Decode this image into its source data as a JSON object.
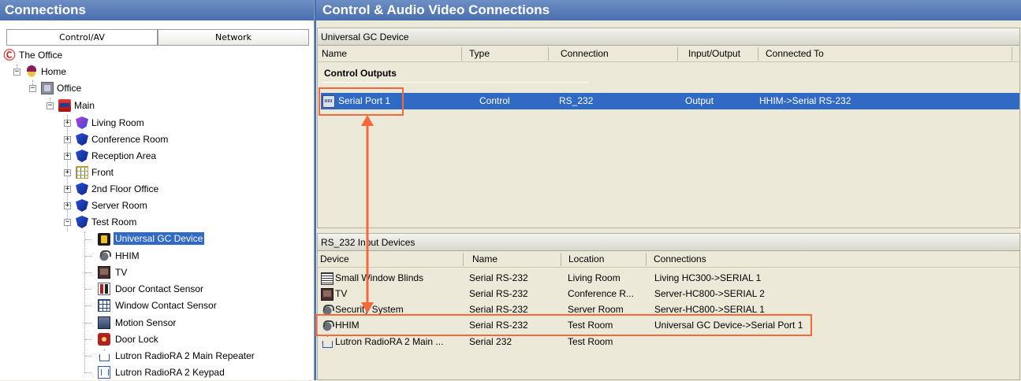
{
  "left": {
    "header": "Connections",
    "tabs": [
      {
        "label": "Control/AV"
      },
      {
        "label": "Network"
      }
    ],
    "tree": [
      {
        "label": "The Office",
        "icon": "c4-logo-icon"
      },
      {
        "label": "Home",
        "icon": "home-icon"
      },
      {
        "label": "Office",
        "icon": "office-icon"
      },
      {
        "label": "Main",
        "icon": "main-icon"
      },
      {
        "label": "Living Room",
        "icon": "room-shield-icon"
      },
      {
        "label": "Conference Room",
        "icon": "room-shield-icon"
      },
      {
        "label": "Reception Area",
        "icon": "room-shield-icon"
      },
      {
        "label": "Front",
        "icon": "front-grid-icon"
      },
      {
        "label": "2nd Floor Office",
        "icon": "room-shield-icon"
      },
      {
        "label": "Server Room",
        "icon": "room-shield-icon"
      },
      {
        "label": "Test Room",
        "icon": "room-shield-icon"
      },
      {
        "label": "Universal GC Device",
        "icon": "gc-device-icon"
      },
      {
        "label": "HHIM",
        "icon": "hhim-icon"
      },
      {
        "label": "TV",
        "icon": "tv-icon"
      },
      {
        "label": "Door Contact Sensor",
        "icon": "door-contact-icon"
      },
      {
        "label": "Window Contact Sensor",
        "icon": "window-contact-icon"
      },
      {
        "label": "Motion Sensor",
        "icon": "motion-sensor-icon"
      },
      {
        "label": "Door Lock",
        "icon": "door-lock-icon"
      },
      {
        "label": "Lutron RadioRA 2 Main Repeater",
        "icon": "lutron-repeater-icon"
      },
      {
        "label": "Lutron RadioRA 2 Keypad",
        "icon": "lutron-keypad-icon"
      }
    ]
  },
  "right": {
    "header": "Control & Audio Video Connections",
    "top_panel": {
      "title": "Universal GC Device",
      "columns": [
        "Name",
        "Type",
        "Connection",
        "Input/Output",
        "Connected To"
      ],
      "group": "Control Outputs",
      "rows": [
        {
          "name": "Serial Port 1",
          "type": "Control",
          "connection": "RS_232",
          "io": "Output",
          "connected_to": "HHIM->Serial RS-232"
        }
      ]
    },
    "bottom_panel": {
      "title": "RS_232 Input Devices",
      "columns": [
        "Device",
        "Name",
        "Location",
        "Connections"
      ],
      "rows": [
        {
          "device": "Small Window Blinds",
          "name": "Serial RS-232",
          "location": "Living Room",
          "connections": "Living HC300->SERIAL 1"
        },
        {
          "device": "TV",
          "name": "Serial RS-232",
          "location": "Conference R...",
          "connections": "Server-HC800->SERIAL 2"
        },
        {
          "device": "Security System",
          "name": "Serial RS-232",
          "location": "Server Room",
          "connections": "Server-HC800->SERIAL 1"
        },
        {
          "device": "HHIM",
          "name": "Serial RS-232",
          "location": "Test Room",
          "connections": "Universal GC Device->Serial Port 1"
        },
        {
          "device": "Lutron RadioRA 2 Main ...",
          "name": "Serial 232",
          "location": "Test Room",
          "connections": ""
        }
      ]
    }
  },
  "colors": {
    "header_blue": "#4a6fb0",
    "selection": "#316ac5",
    "highlight": "#f26a3c"
  }
}
